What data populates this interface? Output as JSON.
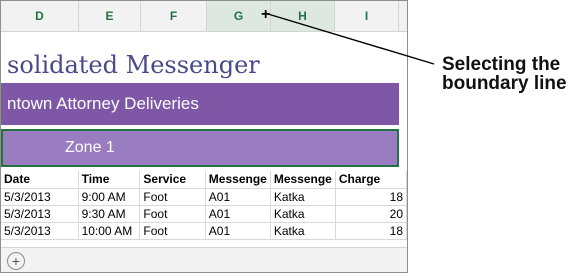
{
  "columns": [
    "D",
    "E",
    "F",
    "G",
    "H",
    "I"
  ],
  "cursor_glyph": "+",
  "title": "solidated Messenger",
  "subtitle": "ntown Attorney Deliveries",
  "zone": "Zone 1",
  "table": {
    "headers": [
      "Date",
      "Time",
      "Service",
      "Messenge",
      "Messenge",
      "Charge"
    ],
    "rows": [
      [
        "5/3/2013",
        "9:00 AM",
        "Foot",
        "A01",
        "Katka",
        "18"
      ],
      [
        "5/3/2013",
        "9:30 AM",
        "Foot",
        "A01",
        "Katka",
        "20"
      ],
      [
        "5/3/2013",
        "10:00 AM",
        "Foot",
        "A01",
        "Katka",
        "18"
      ]
    ]
  },
  "add_sheet_symbol": "+",
  "callout": {
    "line1": "Selecting the",
    "line2": "boundary line"
  },
  "colors": {
    "header_green": "#217346",
    "band_dark": "#7e57a6",
    "band_light": "#9a7cc0",
    "title_text": "#4a4a8a"
  }
}
